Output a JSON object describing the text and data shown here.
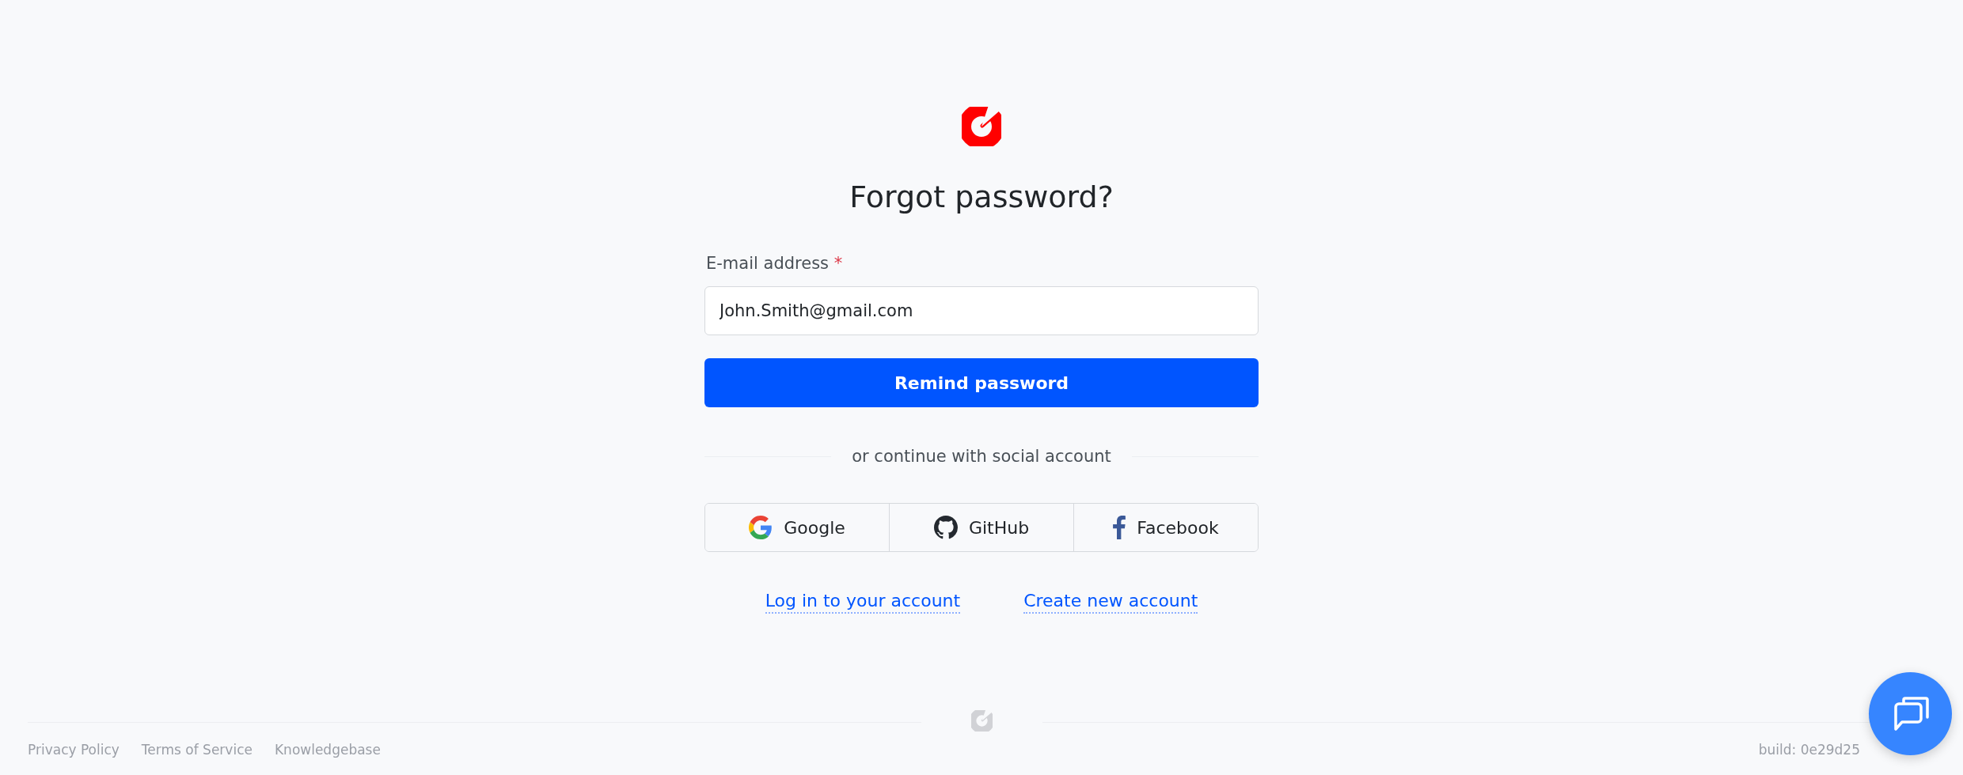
{
  "title": "Forgot password?",
  "email_field": {
    "label": "E-mail address",
    "required_mark": "*",
    "value": "John.Smith@gmail.com"
  },
  "submit_button": "Remind password",
  "divider_text": "or continue with social account",
  "social_buttons": [
    {
      "kind": "google",
      "label": "Google"
    },
    {
      "kind": "github",
      "label": "GitHub"
    },
    {
      "kind": "facebook",
      "label": "Facebook"
    }
  ],
  "links": [
    "Log in to your account",
    "Create new account"
  ],
  "footer": {
    "links": [
      "Privacy Policy",
      "Terms of Service",
      "Knowledgebase"
    ],
    "build": "build: 0e29d25"
  }
}
